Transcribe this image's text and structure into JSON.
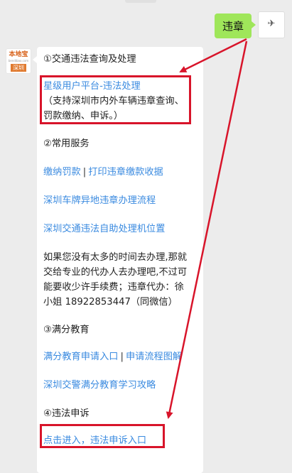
{
  "outgoing": {
    "text": "违章"
  },
  "incoming": {
    "bot_avatar": {
      "brand": "本地宝",
      "subtitle": "bendibao.com",
      "city": "深圳"
    },
    "sections": {
      "s1_title": "①交通违法查询及处理",
      "s1_link": "星级用户平台-违法处理",
      "s1_note_1": "（支持深圳市内外车辆违章查询、",
      "s1_note_2": "罚款缴纳、申诉。）",
      "s2_title": "②常用服务",
      "s2_link_a": "缴纳罚款",
      "s2_sep": "|",
      "s2_link_b": "打印违章缴款收据",
      "s2_link_c": "深圳车牌异地违章办理流程",
      "s2_link_d": "深圳交通违法自助处理机位置",
      "agent_1": "如果您没有太多的时间去办理,那就",
      "agent_2": "交给专业的代办人去办理吧,不过可",
      "agent_3": "能要收少许手续费；违章代办：徐",
      "agent_4": "小姐 18922853447（同微信）",
      "s3_title": "③满分教育",
      "s3_link_a": "满分教育申请入口",
      "s3_sep": "|",
      "s3_link_b": "申请流程图解",
      "s3_link_c": "深圳交警满分教育学习攻略",
      "s4_title": "④违法申诉",
      "s4_link": "点击进入，违法申诉入口"
    }
  },
  "colors": {
    "link": "#3b8be0",
    "annotation": "#d8142a",
    "bubble_out": "#9fe65a"
  }
}
